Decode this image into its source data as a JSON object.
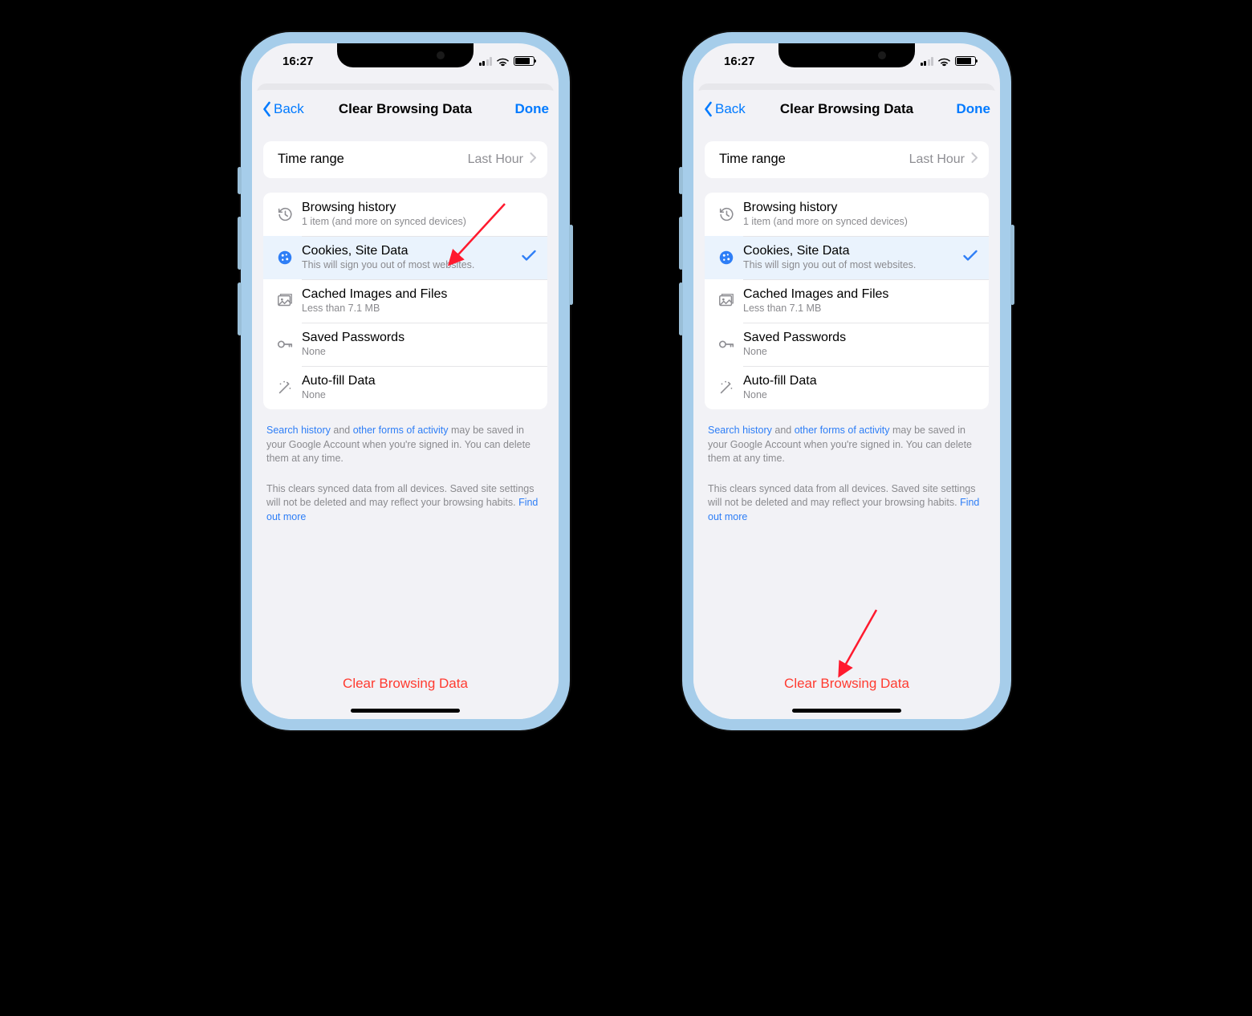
{
  "status": {
    "time": "16:27"
  },
  "nav": {
    "back": "Back",
    "title": "Clear Browsing Data",
    "done": "Done"
  },
  "time_range": {
    "label": "Time range",
    "value": "Last Hour"
  },
  "items": {
    "history": {
      "title": "Browsing history",
      "sub": "1 item (and more on synced devices)"
    },
    "cookies": {
      "title": "Cookies, Site Data",
      "sub": "This will sign you out of most websites."
    },
    "cache": {
      "title": "Cached Images and Files",
      "sub": "Less than 7.1 MB"
    },
    "passwords": {
      "title": "Saved Passwords",
      "sub": "None"
    },
    "autofill": {
      "title": "Auto-fill Data",
      "sub": "None"
    }
  },
  "info1": {
    "link1": "Search history",
    "mid1": " and ",
    "link2": "other forms of activity",
    "rest": " may be saved in your Google Account when you're signed in. You can delete them at any time."
  },
  "info2": {
    "text": "This clears synced data from all devices. Saved site settings will not be deleted and may reflect your browsing habits. ",
    "link": "Find out more"
  },
  "clear_button": "Clear Browsing Data"
}
